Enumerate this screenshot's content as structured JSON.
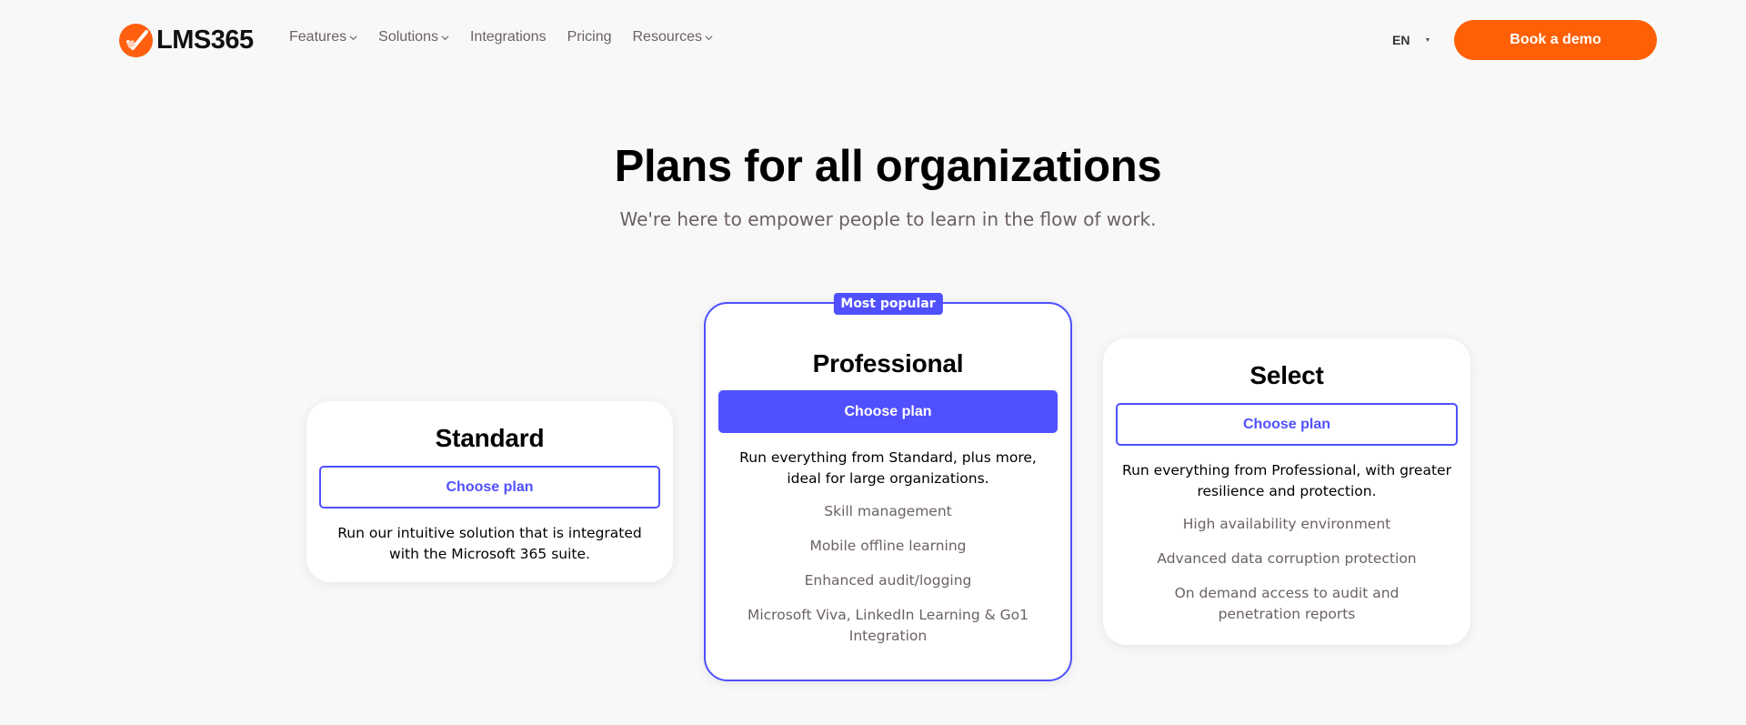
{
  "brand": {
    "name": "LMS365",
    "accent_color": "#ff5f05",
    "logo_icon": "check-circle-icon"
  },
  "nav": {
    "items": [
      {
        "label": "Features",
        "has_dropdown": true
      },
      {
        "label": "Solutions",
        "has_dropdown": true
      },
      {
        "label": "Integrations",
        "has_dropdown": false
      },
      {
        "label": "Pricing",
        "has_dropdown": false
      },
      {
        "label": "Resources",
        "has_dropdown": true
      }
    ],
    "language": "EN",
    "cta_label": "Book a demo"
  },
  "hero": {
    "title": "Plans for all organizations",
    "subtitle": "We're here to empower people to learn in the flow of work."
  },
  "plans": [
    {
      "name": "Standard",
      "button_label": "Choose plan",
      "description": "Run our intuitive solution that is integrated with the Microsoft 365 suite.",
      "features": []
    },
    {
      "name": "Professional",
      "badge": "Most popular",
      "button_label": "Choose plan",
      "description": "Run everything from Standard, plus more, ideal for large organizations.",
      "features": [
        "Skill management",
        "Mobile offline learning",
        "Enhanced audit/logging",
        "Microsoft Viva, LinkedIn Learning & Go1 Integration"
      ]
    },
    {
      "name": "Select",
      "button_label": "Choose plan",
      "description": "Run everything from Professional, with greater resilience and protection.",
      "features": [
        "High availability environment",
        "Advanced data corruption protection",
        "On demand access to audit and penetration reports"
      ]
    }
  ],
  "colors": {
    "plan_accent": "#5050ff",
    "muted_text": "#6b6164",
    "background": "#f8f8f8"
  }
}
